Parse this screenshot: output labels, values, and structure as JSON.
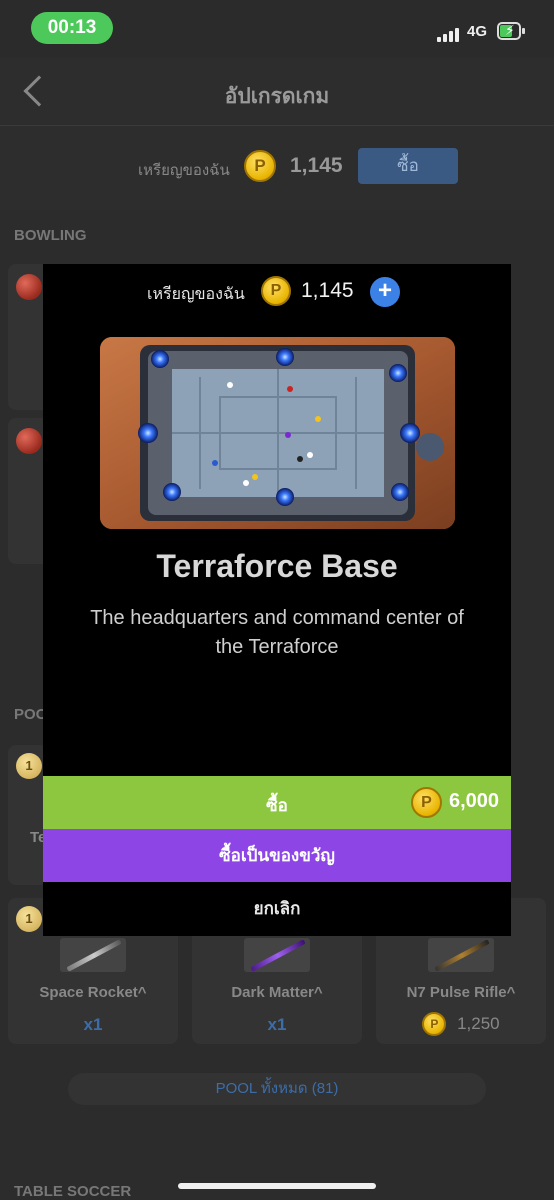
{
  "status_bar": {
    "time": "00:13",
    "network": "4G"
  },
  "header": {
    "title": "อัปเกรดเกม"
  },
  "coins_bar": {
    "label": "เหรียญของฉัน",
    "coin_symbol": "P",
    "value": "1,145",
    "buy_label": "ซื้อ"
  },
  "sections": {
    "bowling": "BOWLING",
    "pool": "POO",
    "table_soccer": "TABLE SOCCER"
  },
  "background_cards": {
    "partial_card_label": "Te",
    "rank_badge": "1",
    "cues": [
      {
        "name": "Space Rocket^",
        "qty": "x1"
      },
      {
        "name": "Dark Matter^",
        "qty": "x1"
      },
      {
        "name": "N7 Pulse Rifle^",
        "price": "1,250"
      }
    ],
    "all_pool_label": "POOL ทั้งหมด (81)"
  },
  "modal": {
    "coins_label": "เหรียญของฉัน",
    "coins_value": "1,145",
    "add_label": "+",
    "item_title": "Terraforce Base",
    "item_description": "The headquarters and command center of the Terraforce",
    "buy_label": "ซื้อ",
    "buy_price": "6,000",
    "gift_label": "ซื้อเป็นของขวัญ",
    "cancel_label": "ยกเลิก"
  },
  "colors": {
    "buy_green": "#8dc63f",
    "gift_purple": "#8d45e6",
    "add_blue": "#3c82e6",
    "coin_gold": "#f2c41c"
  },
  "icons": [
    "back-chevron-icon",
    "coin-icon",
    "plus-icon",
    "signal-icon",
    "battery-charging-icon",
    "bowling-ball-icon",
    "pool-cue-icon"
  ]
}
